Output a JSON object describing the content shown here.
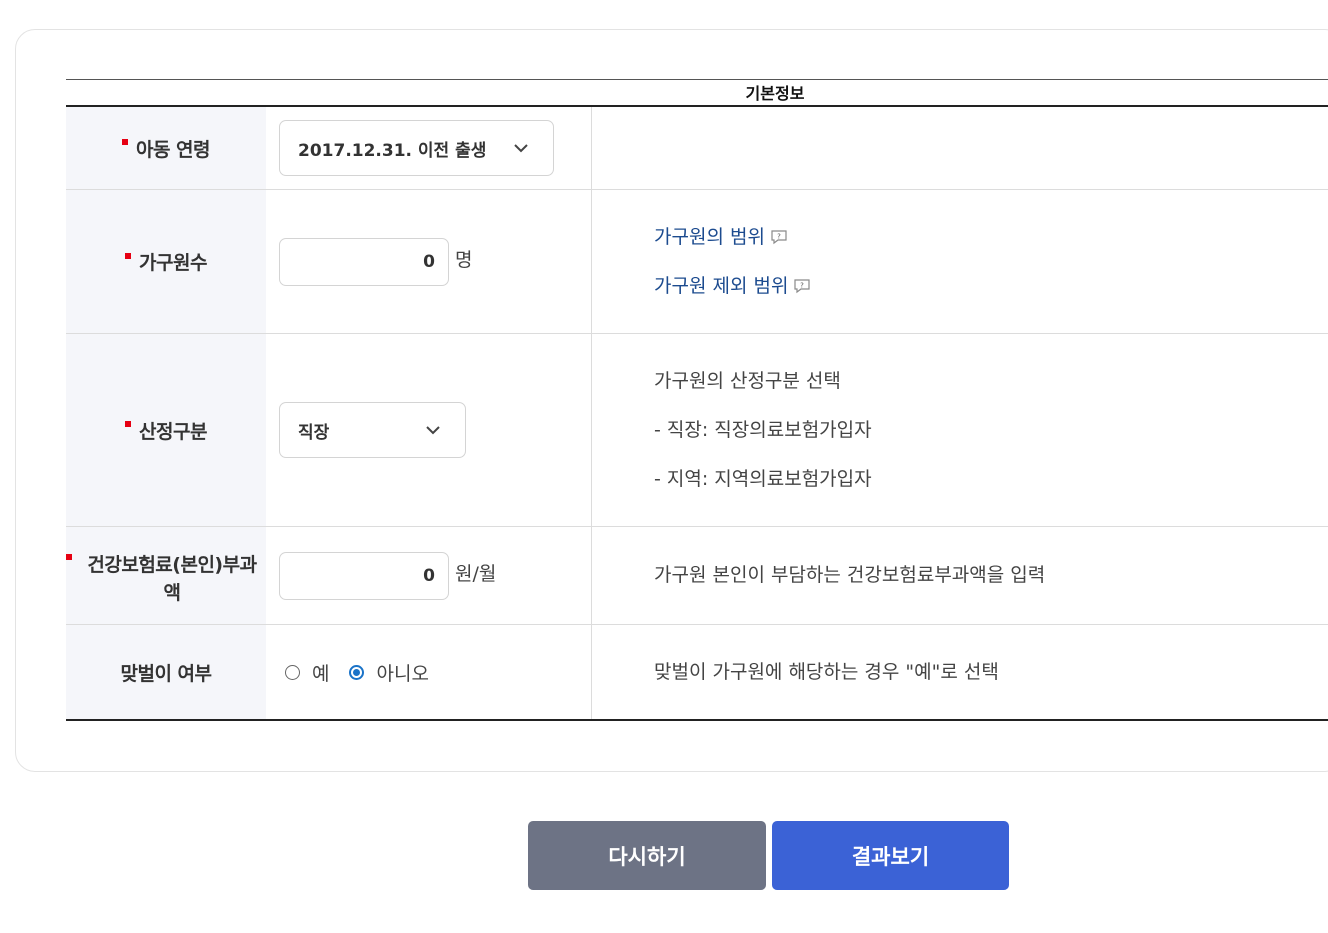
{
  "section": {
    "caption": "기본정보"
  },
  "rows": {
    "child_age": {
      "label": "아동 연령",
      "selected": "2017.12.31. 이전 출생"
    },
    "household": {
      "label": "가구원수",
      "value": "0",
      "unit": "명",
      "links": [
        "가구원의 범위",
        "가구원 제외 범위"
      ]
    },
    "category": {
      "label": "산정구분",
      "selected": "직장",
      "desc": [
        "가구원의 산정구분 선택",
        "- 직장: 직장의료보험가입자",
        "- 지역: 지역의료보험가입자"
      ]
    },
    "insurance": {
      "label_line1": "건강보험료(본인)부과",
      "label_line2": "액",
      "value": "0",
      "unit": "원/월",
      "desc": "가구원 본인이 부담하는 건강보험료부과액을 입력"
    },
    "dual_income": {
      "label": "맞벌이 여부",
      "options": [
        "예",
        "아니오"
      ],
      "selected": "아니오",
      "desc": "맞벌이 가구원에 해당하는 경우 \"예\"로 선택"
    }
  },
  "buttons": {
    "reset": "다시하기",
    "result": "결과보기"
  },
  "colors": {
    "required": "#e60012",
    "link": "#1c4b8f",
    "primary": "#3b62d6",
    "secondary": "#6d7385"
  }
}
